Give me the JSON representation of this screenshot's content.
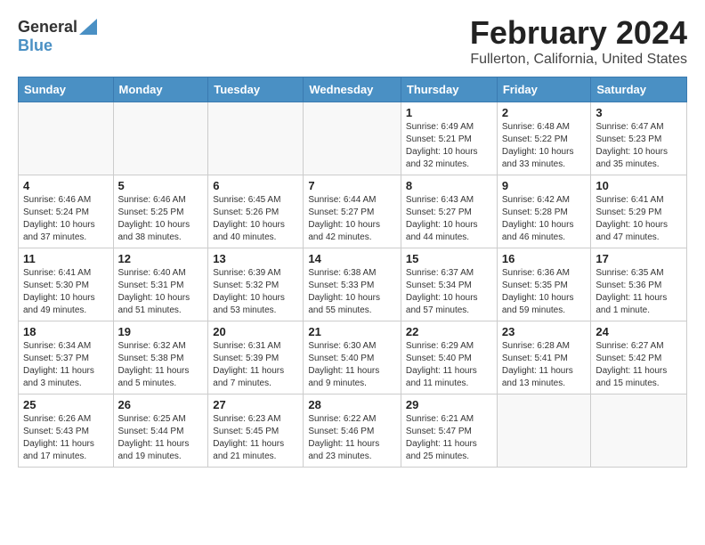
{
  "header": {
    "logo_general": "General",
    "logo_blue": "Blue",
    "month": "February 2024",
    "location": "Fullerton, California, United States"
  },
  "weekdays": [
    "Sunday",
    "Monday",
    "Tuesday",
    "Wednesday",
    "Thursday",
    "Friday",
    "Saturday"
  ],
  "weeks": [
    [
      {
        "day": "",
        "sunrise": "",
        "sunset": "",
        "daylight": ""
      },
      {
        "day": "",
        "sunrise": "",
        "sunset": "",
        "daylight": ""
      },
      {
        "day": "",
        "sunrise": "",
        "sunset": "",
        "daylight": ""
      },
      {
        "day": "",
        "sunrise": "",
        "sunset": "",
        "daylight": ""
      },
      {
        "day": "1",
        "sunrise": "Sunrise: 6:49 AM",
        "sunset": "Sunset: 5:21 PM",
        "daylight": "Daylight: 10 hours and 32 minutes."
      },
      {
        "day": "2",
        "sunrise": "Sunrise: 6:48 AM",
        "sunset": "Sunset: 5:22 PM",
        "daylight": "Daylight: 10 hours and 33 minutes."
      },
      {
        "day": "3",
        "sunrise": "Sunrise: 6:47 AM",
        "sunset": "Sunset: 5:23 PM",
        "daylight": "Daylight: 10 hours and 35 minutes."
      }
    ],
    [
      {
        "day": "4",
        "sunrise": "Sunrise: 6:46 AM",
        "sunset": "Sunset: 5:24 PM",
        "daylight": "Daylight: 10 hours and 37 minutes."
      },
      {
        "day": "5",
        "sunrise": "Sunrise: 6:46 AM",
        "sunset": "Sunset: 5:25 PM",
        "daylight": "Daylight: 10 hours and 38 minutes."
      },
      {
        "day": "6",
        "sunrise": "Sunrise: 6:45 AM",
        "sunset": "Sunset: 5:26 PM",
        "daylight": "Daylight: 10 hours and 40 minutes."
      },
      {
        "day": "7",
        "sunrise": "Sunrise: 6:44 AM",
        "sunset": "Sunset: 5:27 PM",
        "daylight": "Daylight: 10 hours and 42 minutes."
      },
      {
        "day": "8",
        "sunrise": "Sunrise: 6:43 AM",
        "sunset": "Sunset: 5:27 PM",
        "daylight": "Daylight: 10 hours and 44 minutes."
      },
      {
        "day": "9",
        "sunrise": "Sunrise: 6:42 AM",
        "sunset": "Sunset: 5:28 PM",
        "daylight": "Daylight: 10 hours and 46 minutes."
      },
      {
        "day": "10",
        "sunrise": "Sunrise: 6:41 AM",
        "sunset": "Sunset: 5:29 PM",
        "daylight": "Daylight: 10 hours and 47 minutes."
      }
    ],
    [
      {
        "day": "11",
        "sunrise": "Sunrise: 6:41 AM",
        "sunset": "Sunset: 5:30 PM",
        "daylight": "Daylight: 10 hours and 49 minutes."
      },
      {
        "day": "12",
        "sunrise": "Sunrise: 6:40 AM",
        "sunset": "Sunset: 5:31 PM",
        "daylight": "Daylight: 10 hours and 51 minutes."
      },
      {
        "day": "13",
        "sunrise": "Sunrise: 6:39 AM",
        "sunset": "Sunset: 5:32 PM",
        "daylight": "Daylight: 10 hours and 53 minutes."
      },
      {
        "day": "14",
        "sunrise": "Sunrise: 6:38 AM",
        "sunset": "Sunset: 5:33 PM",
        "daylight": "Daylight: 10 hours and 55 minutes."
      },
      {
        "day": "15",
        "sunrise": "Sunrise: 6:37 AM",
        "sunset": "Sunset: 5:34 PM",
        "daylight": "Daylight: 10 hours and 57 minutes."
      },
      {
        "day": "16",
        "sunrise": "Sunrise: 6:36 AM",
        "sunset": "Sunset: 5:35 PM",
        "daylight": "Daylight: 10 hours and 59 minutes."
      },
      {
        "day": "17",
        "sunrise": "Sunrise: 6:35 AM",
        "sunset": "Sunset: 5:36 PM",
        "daylight": "Daylight: 11 hours and 1 minute."
      }
    ],
    [
      {
        "day": "18",
        "sunrise": "Sunrise: 6:34 AM",
        "sunset": "Sunset: 5:37 PM",
        "daylight": "Daylight: 11 hours and 3 minutes."
      },
      {
        "day": "19",
        "sunrise": "Sunrise: 6:32 AM",
        "sunset": "Sunset: 5:38 PM",
        "daylight": "Daylight: 11 hours and 5 minutes."
      },
      {
        "day": "20",
        "sunrise": "Sunrise: 6:31 AM",
        "sunset": "Sunset: 5:39 PM",
        "daylight": "Daylight: 11 hours and 7 minutes."
      },
      {
        "day": "21",
        "sunrise": "Sunrise: 6:30 AM",
        "sunset": "Sunset: 5:40 PM",
        "daylight": "Daylight: 11 hours and 9 minutes."
      },
      {
        "day": "22",
        "sunrise": "Sunrise: 6:29 AM",
        "sunset": "Sunset: 5:40 PM",
        "daylight": "Daylight: 11 hours and 11 minutes."
      },
      {
        "day": "23",
        "sunrise": "Sunrise: 6:28 AM",
        "sunset": "Sunset: 5:41 PM",
        "daylight": "Daylight: 11 hours and 13 minutes."
      },
      {
        "day": "24",
        "sunrise": "Sunrise: 6:27 AM",
        "sunset": "Sunset: 5:42 PM",
        "daylight": "Daylight: 11 hours and 15 minutes."
      }
    ],
    [
      {
        "day": "25",
        "sunrise": "Sunrise: 6:26 AM",
        "sunset": "Sunset: 5:43 PM",
        "daylight": "Daylight: 11 hours and 17 minutes."
      },
      {
        "day": "26",
        "sunrise": "Sunrise: 6:25 AM",
        "sunset": "Sunset: 5:44 PM",
        "daylight": "Daylight: 11 hours and 19 minutes."
      },
      {
        "day": "27",
        "sunrise": "Sunrise: 6:23 AM",
        "sunset": "Sunset: 5:45 PM",
        "daylight": "Daylight: 11 hours and 21 minutes."
      },
      {
        "day": "28",
        "sunrise": "Sunrise: 6:22 AM",
        "sunset": "Sunset: 5:46 PM",
        "daylight": "Daylight: 11 hours and 23 minutes."
      },
      {
        "day": "29",
        "sunrise": "Sunrise: 6:21 AM",
        "sunset": "Sunset: 5:47 PM",
        "daylight": "Daylight: 11 hours and 25 minutes."
      },
      {
        "day": "",
        "sunrise": "",
        "sunset": "",
        "daylight": ""
      },
      {
        "day": "",
        "sunrise": "",
        "sunset": "",
        "daylight": ""
      }
    ]
  ]
}
